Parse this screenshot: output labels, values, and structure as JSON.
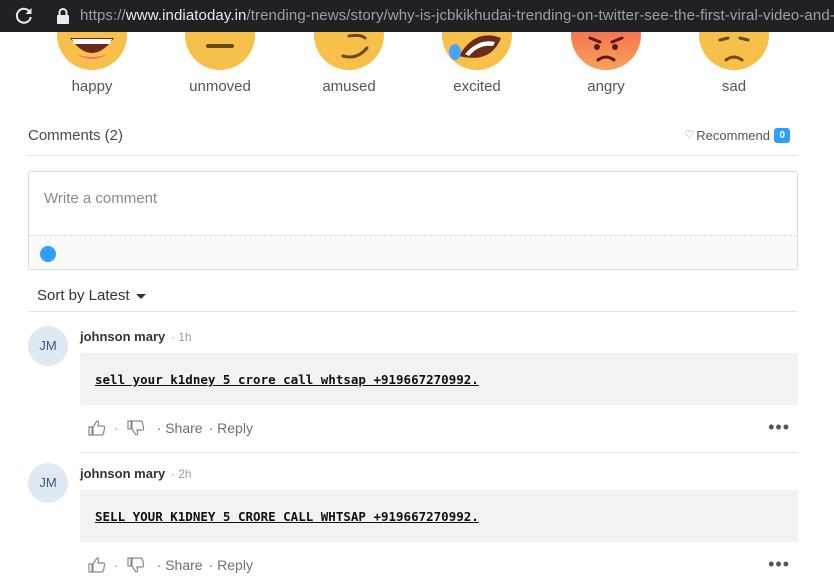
{
  "browser": {
    "url_scheme": "https://",
    "url_host": "www.indiatoday.in",
    "url_path": "/trending-news/story/why-is-jcbkikhudai-trending-on-twitter-see-the-first-viral-video-and-best-"
  },
  "reactions": [
    {
      "label": "happy",
      "icon": "happy-face-icon"
    },
    {
      "label": "unmoved",
      "icon": "neutral-face-icon"
    },
    {
      "label": "amused",
      "icon": "smirk-face-icon"
    },
    {
      "label": "excited",
      "icon": "laughing-face-icon"
    },
    {
      "label": "angry",
      "icon": "angry-face-icon"
    },
    {
      "label": "sad",
      "icon": "sad-face-icon"
    }
  ],
  "comments_header": {
    "title": "Comments (2)",
    "recommend_label": "Recommend",
    "recommend_count": "0"
  },
  "editor": {
    "placeholder": "Write a comment"
  },
  "sort": {
    "label": "Sort by Latest"
  },
  "comments": [
    {
      "initials": "JM",
      "author": "johnson mary",
      "time": "· 1h",
      "text": "sell your k1dney 5 crore call whtsap +919667270992.",
      "share": "· Share",
      "reply": "· Reply",
      "dot": "·",
      "more": "•••"
    },
    {
      "initials": "JM",
      "author": "johnson mary",
      "time": "· 2h",
      "text": "SELL YOUR K1DNEY 5 CRORE CALL WHTSAP +919667270992.",
      "share": "· Share",
      "reply": "· Reply",
      "dot": "·",
      "more": "•••"
    }
  ],
  "colors": {
    "accent": "#2e9fff",
    "urlbar_bg": "#202124",
    "emoji_yellow": "#f7c04a",
    "emoji_angry": "#f26a4b"
  }
}
